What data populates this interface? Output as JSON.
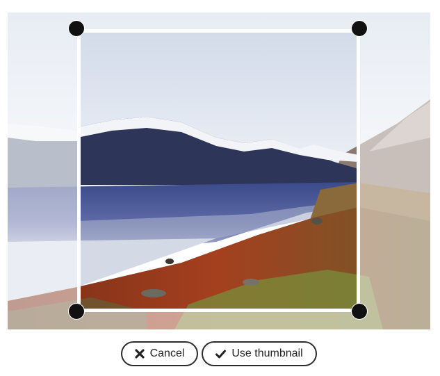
{
  "crop_editor": {
    "image": {
      "description_icon": "landscape-photo"
    },
    "buttons": {
      "cancel_label": "Cancel",
      "cancel_icon": "close-icon",
      "use_label": "Use thumbnail",
      "use_icon": "check-icon"
    }
  }
}
